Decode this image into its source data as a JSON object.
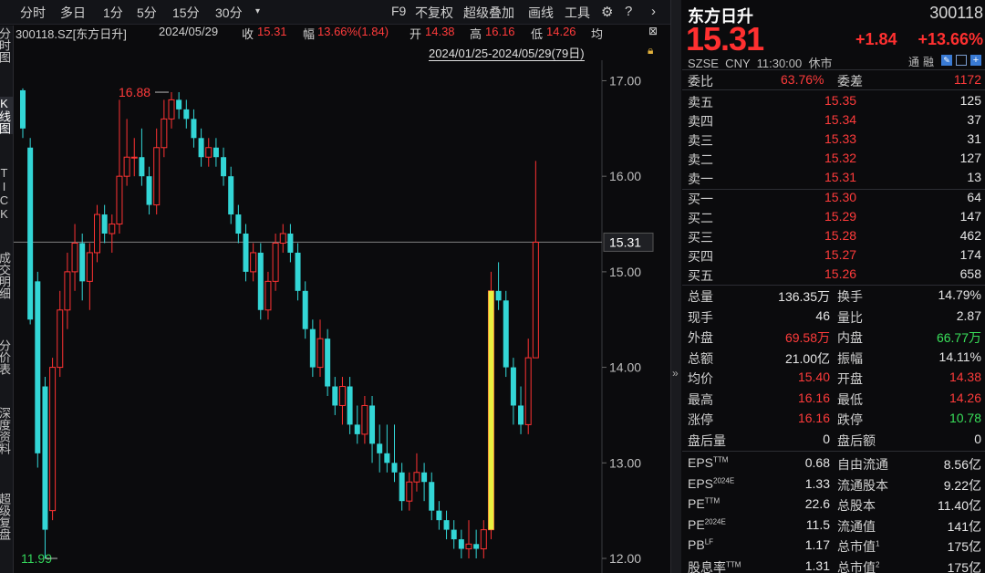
{
  "toolbar": {
    "periods": [
      "分时",
      "多日",
      "1分",
      "5分",
      "15分",
      "30分"
    ],
    "dropdown_icon": "triangle-down-icon",
    "f9": "F9",
    "adjust": "不复权",
    "overlay": "超级叠加",
    "draw": "画线",
    "tools": "工具",
    "icons": [
      "gear-icon",
      "help-icon",
      "chevron-right-icon"
    ]
  },
  "side_tabs": [
    "分时图",
    "K线图",
    "TICK",
    "成交明细",
    "分价表",
    "深度资料",
    "超级复盘"
  ],
  "info": {
    "code": "300118.SZ[东方日升]",
    "date": "2024/05/29",
    "close_label": "收",
    "close": "15.31",
    "change_label": "幅",
    "change": "13.66%(1.84)",
    "open_label": "开",
    "open": "14.38",
    "high_label": "高",
    "high": "16.16",
    "low_label": "低",
    "low": "14.26",
    "avg_label": "均"
  },
  "range": "2024/01/25-2024/05/29(79日)",
  "chart_data": {
    "type": "candlestick",
    "y_ticks": [
      "17.00",
      "16.00",
      "15.00",
      "14.00",
      "13.00",
      "12.00"
    ],
    "ylim": [
      11.9,
      17.2
    ],
    "last_price": "15.31",
    "max_label": "16.88",
    "min_label": "11.99",
    "up_color": "#ff3333",
    "down_color": "#33d6d6",
    "candles": [
      [
        16.9,
        16.5,
        16.92,
        16.4
      ],
      [
        16.3,
        14.5,
        16.4,
        14.45
      ],
      [
        14.9,
        13.1,
        15.0,
        12.95
      ],
      [
        13.8,
        12.3,
        13.9,
        12.0
      ],
      [
        12.5,
        14.0,
        14.1,
        12.4
      ],
      [
        14.0,
        14.6,
        14.8,
        13.9
      ],
      [
        14.6,
        15.0,
        15.2,
        14.4
      ],
      [
        15.0,
        15.3,
        15.5,
        14.8
      ],
      [
        15.3,
        14.9,
        15.4,
        14.7
      ],
      [
        14.9,
        15.2,
        15.3,
        14.6
      ],
      [
        15.2,
        15.6,
        15.7,
        15.1
      ],
      [
        15.6,
        15.4,
        15.7,
        15.3
      ],
      [
        15.4,
        15.5,
        15.6,
        15.2
      ],
      [
        15.5,
        16.0,
        16.8,
        15.4
      ],
      [
        16.0,
        16.2,
        16.6,
        15.9
      ],
      [
        16.2,
        16.2,
        16.4,
        16.0
      ],
      [
        16.2,
        16.0,
        16.5,
        15.9
      ],
      [
        16.0,
        15.7,
        16.1,
        15.6
      ],
      [
        15.7,
        16.3,
        16.5,
        15.6
      ],
      [
        16.3,
        16.6,
        16.8,
        16.2
      ],
      [
        16.6,
        16.8,
        16.88,
        16.5
      ],
      [
        16.8,
        16.7,
        16.88,
        16.6
      ],
      [
        16.7,
        16.6,
        16.8,
        16.5
      ],
      [
        16.6,
        16.4,
        16.7,
        16.3
      ],
      [
        16.4,
        16.2,
        16.5,
        16.1
      ],
      [
        16.2,
        16.3,
        16.4,
        16.1
      ],
      [
        16.3,
        16.2,
        16.4,
        16.1
      ],
      [
        16.2,
        16.0,
        16.3,
        15.9
      ],
      [
        16.0,
        15.6,
        16.1,
        15.5
      ],
      [
        15.6,
        15.4,
        15.7,
        15.3
      ],
      [
        15.4,
        15.0,
        15.5,
        14.9
      ],
      [
        15.0,
        15.2,
        15.3,
        14.9
      ],
      [
        15.2,
        14.6,
        15.3,
        14.5
      ],
      [
        14.6,
        14.9,
        15.0,
        14.5
      ],
      [
        14.9,
        15.3,
        15.4,
        14.8
      ],
      [
        15.3,
        15.4,
        15.5,
        15.2
      ],
      [
        15.4,
        15.2,
        15.5,
        15.1
      ],
      [
        15.2,
        14.8,
        15.3,
        14.7
      ],
      [
        14.8,
        14.4,
        14.9,
        14.3
      ],
      [
        14.4,
        14.0,
        14.5,
        13.9
      ],
      [
        14.0,
        14.3,
        14.5,
        13.9
      ],
      [
        14.3,
        13.8,
        14.4,
        13.7
      ],
      [
        13.8,
        13.6,
        13.9,
        13.5
      ],
      [
        13.6,
        13.8,
        13.9,
        13.4
      ],
      [
        13.8,
        13.4,
        13.9,
        13.3
      ],
      [
        13.4,
        13.3,
        13.6,
        13.2
      ],
      [
        13.3,
        13.6,
        13.7,
        13.2
      ],
      [
        13.6,
        13.2,
        13.7,
        13.0
      ],
      [
        13.2,
        13.1,
        13.4,
        12.9
      ],
      [
        13.1,
        13.0,
        13.4,
        12.9
      ],
      [
        13.0,
        12.9,
        13.4,
        12.8
      ],
      [
        12.9,
        12.6,
        13.0,
        12.5
      ],
      [
        12.6,
        12.8,
        12.9,
        12.5
      ],
      [
        12.8,
        12.9,
        13.1,
        12.7
      ],
      [
        12.9,
        12.8,
        13.0,
        12.6
      ],
      [
        12.8,
        12.5,
        12.9,
        12.4
      ],
      [
        12.5,
        12.4,
        12.6,
        12.3
      ],
      [
        12.4,
        12.3,
        12.5,
        12.2
      ],
      [
        12.3,
        12.2,
        12.4,
        12.1
      ],
      [
        12.2,
        12.1,
        12.3,
        12.0
      ],
      [
        12.1,
        12.15,
        12.4,
        12.0
      ],
      [
        12.15,
        12.1,
        12.3,
        12.0
      ],
      [
        12.1,
        12.3,
        12.4,
        12.0
      ],
      [
        12.3,
        14.8,
        15.0,
        12.2
      ],
      [
        14.8,
        14.7,
        15.1,
        14.6
      ],
      [
        14.7,
        14.0,
        14.8,
        13.9
      ],
      [
        14.0,
        13.6,
        14.1,
        13.4
      ],
      [
        13.6,
        13.4,
        13.8,
        13.3
      ],
      [
        13.4,
        14.1,
        14.3,
        13.3
      ],
      [
        14.1,
        15.31,
        16.16,
        14.26
      ]
    ]
  },
  "quote": {
    "name": "东方日升",
    "code": "300118",
    "price": "15.31",
    "change": "+1.84",
    "change_pct": "+13.66%",
    "meta": "SZSE  CNY  11:30:00  休市",
    "tags": [
      "通",
      "融"
    ],
    "tag_icons": [
      "edit-icon",
      "window-icon",
      "add-icon"
    ],
    "weibi_label": "委比",
    "weibi": "63.76%",
    "weicha_label": "委差",
    "weicha": "1172",
    "asks": [
      {
        "label": "卖五",
        "price": "15.35",
        "vol": "125"
      },
      {
        "label": "卖四",
        "price": "15.34",
        "vol": "37"
      },
      {
        "label": "卖三",
        "price": "15.33",
        "vol": "31"
      },
      {
        "label": "卖二",
        "price": "15.32",
        "vol": "127"
      },
      {
        "label": "卖一",
        "price": "15.31",
        "vol": "13"
      }
    ],
    "bids": [
      {
        "label": "买一",
        "price": "15.30",
        "vol": "64"
      },
      {
        "label": "买二",
        "price": "15.29",
        "vol": "147"
      },
      {
        "label": "买三",
        "price": "15.28",
        "vol": "462"
      },
      {
        "label": "买四",
        "price": "15.27",
        "vol": "174"
      },
      {
        "label": "买五",
        "price": "15.26",
        "vol": "658"
      }
    ],
    "stats": [
      {
        "l1": "总量",
        "v1": "136.35万",
        "c1": "white",
        "l2": "换手",
        "v2": "14.79%",
        "c2": "white"
      },
      {
        "l1": "现手",
        "v1": "46",
        "c1": "white",
        "l2": "量比",
        "v2": "2.87",
        "c2": "white"
      },
      {
        "l1": "外盘",
        "v1": "69.58万",
        "c1": "red",
        "l2": "内盘",
        "v2": "66.77万",
        "c2": "grn"
      },
      {
        "l1": "总额",
        "v1": "21.00亿",
        "c1": "white",
        "l2": "振幅",
        "v2": "14.11%",
        "c2": "white"
      },
      {
        "l1": "均价",
        "v1": "15.40",
        "c1": "red",
        "l2": "开盘",
        "v2": "14.38",
        "c2": "red"
      },
      {
        "l1": "最高",
        "v1": "16.16",
        "c1": "red",
        "l2": "最低",
        "v2": "14.26",
        "c2": "red"
      },
      {
        "l1": "涨停",
        "v1": "16.16",
        "c1": "red",
        "l2": "跌停",
        "v2": "10.78",
        "c2": "grn"
      },
      {
        "l1": "盘后量",
        "v1": "0",
        "c1": "white",
        "l2": "盘后额",
        "v2": "0",
        "c2": "white"
      }
    ],
    "fundamentals": [
      {
        "l1": "EPS",
        "s1": "TTM",
        "v1": "0.68",
        "l2": "自由流通",
        "s2": "",
        "v2": "8.56亿"
      },
      {
        "l1": "EPS",
        "s1": "2024E",
        "v1": "1.33",
        "l2": "流通股本",
        "s2": "",
        "v2": "9.22亿"
      },
      {
        "l1": "PE",
        "s1": "TTM",
        "v1": "22.6",
        "l2": "总股本",
        "s2": "",
        "v2": "11.40亿"
      },
      {
        "l1": "PE",
        "s1": "2024E",
        "v1": "11.5",
        "l2": "流通值",
        "s2": "",
        "v2": "141亿"
      },
      {
        "l1": "PB",
        "s1": "LF",
        "v1": "1.17",
        "l2": "总市值",
        "s2": "1",
        "v2": "175亿"
      },
      {
        "l1": "股息率",
        "s1": "TTM",
        "v1": "1.31",
        "l2": "总市值",
        "s2": "2",
        "v2": "175亿"
      }
    ]
  }
}
